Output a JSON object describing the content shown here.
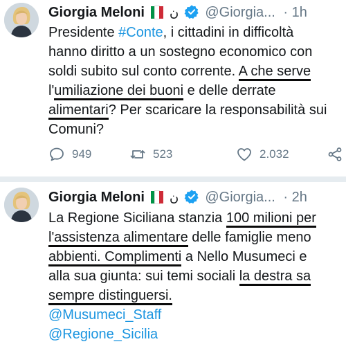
{
  "tweets": [
    {
      "author_name": "Giorgia Meloni",
      "author_badge": "ن",
      "handle": "@Giorgia...",
      "time": "· 1h",
      "lines": [
        [
          "Presidente ",
          "#Conte",
          ", i cittadini in difficoltà"
        ],
        [
          "hanno diritto a un sostegno economico con"
        ],
        [
          "soldi subito sul conto corrente. ",
          "A che serve"
        ],
        [
          "l'",
          "umiliazione dei buoni",
          " e delle derrate"
        ],
        [
          "alimentari",
          "? Per scaricare la responsabilità sui"
        ],
        [
          "Comuni?"
        ]
      ],
      "actions": {
        "reply_count": "949",
        "retweet_count": "523",
        "like_count": "2.032"
      }
    },
    {
      "author_name": "Giorgia Meloni",
      "author_badge": "ن",
      "handle": "@Giorgia...",
      "time": "· 2h",
      "lines": [
        [
          "La Regione Siciliana stanzia ",
          "100 milioni per"
        ],
        [
          "l'assistenza alimentare",
          " delle famiglie meno"
        ],
        [
          "abbienti. ",
          "Complimenti",
          " a Nello Musumeci e"
        ],
        [
          "alla sua giunta: sui temi sociali ",
          "la destra sa"
        ],
        [
          "sempre distinguersi."
        ],
        [
          "@Musumeci_Staff"
        ],
        [
          "@Regione_Sicilia"
        ]
      ]
    }
  ],
  "colors": {
    "link": "#1b95e0",
    "verified": "#1da1f2",
    "muted": "#657786",
    "flag_green": "#009246",
    "flag_white": "#ffffff",
    "flag_red": "#ce2b37",
    "underline": "#0a0a0a"
  },
  "icons": [
    "avatar",
    "italy-flag-icon",
    "verified-badge-icon",
    "reply-icon",
    "retweet-icon",
    "like-icon",
    "share-icon"
  ]
}
